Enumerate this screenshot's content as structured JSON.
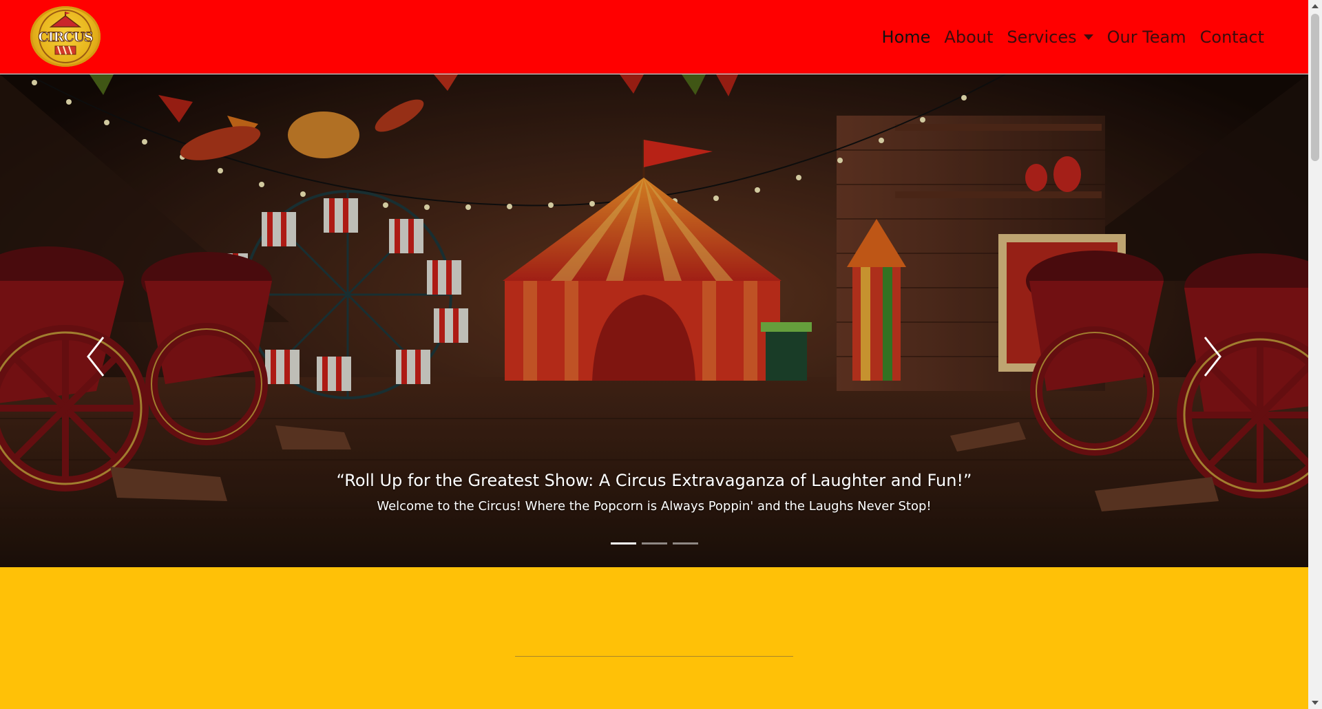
{
  "brand": {
    "logo_text": "CIRCUS"
  },
  "nav": {
    "items": [
      {
        "label": "Home",
        "active": true
      },
      {
        "label": "About"
      },
      {
        "label": "Services",
        "dropdown": true
      },
      {
        "label": "Our Team"
      },
      {
        "label": "Contact"
      }
    ]
  },
  "carousel": {
    "caption_title": "“Roll Up for the Greatest Show: A Circus Extravaganza of Laughter and Fun!”",
    "caption_text": "Welcome to the Circus! Where the Popcorn is Always Poppin' and the Laughs Never Stop!",
    "slide_count": 3,
    "active_slide": 1,
    "prev_icon": "chevron-left-icon",
    "next_icon": "chevron-right-icon"
  },
  "colors": {
    "navbar": "#ff0000",
    "section": "#ffc107",
    "nav_text": "#3b0d0d"
  }
}
